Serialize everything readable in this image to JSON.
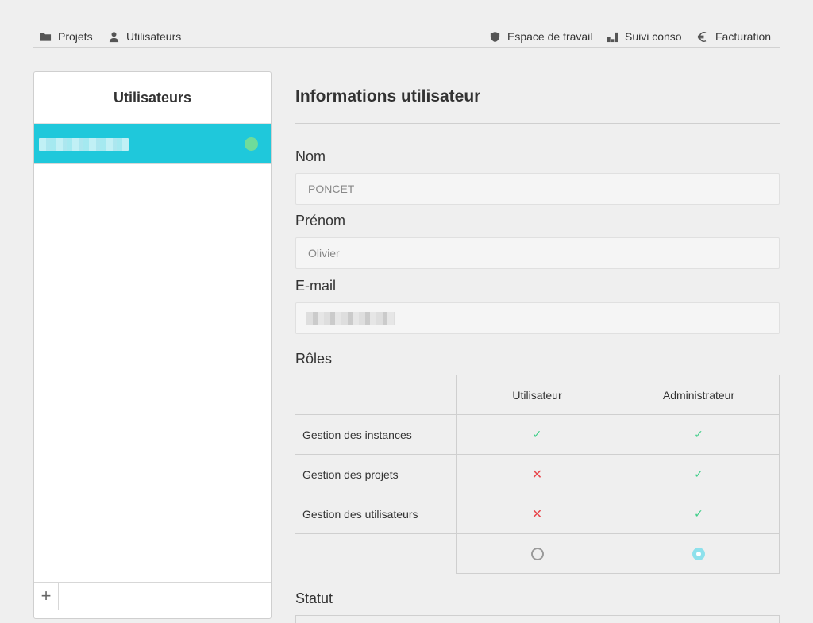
{
  "nav": {
    "left": [
      {
        "label": "Projets",
        "icon": "folder-icon"
      },
      {
        "label": "Utilisateurs",
        "icon": "user-icon"
      }
    ],
    "right": [
      {
        "label": "Espace de travail",
        "icon": "shield-icon"
      },
      {
        "label": "Suivi conso",
        "icon": "bar-chart-icon"
      },
      {
        "label": "Facturation",
        "icon": "euro-icon"
      }
    ]
  },
  "sidebar": {
    "title": "Utilisateurs",
    "selected_user": {
      "status_color": "#6fdc9a"
    },
    "add_label": "+"
  },
  "main": {
    "title": "Informations utilisateur",
    "fields": {
      "nom": {
        "label": "Nom",
        "value": "PONCET"
      },
      "prenom": {
        "label": "Prénom",
        "value": "Olivier"
      },
      "email": {
        "label": "E-mail"
      }
    },
    "roles": {
      "label": "Rôles",
      "columns": [
        "Utilisateur",
        "Administrateur"
      ],
      "rows": [
        {
          "label": "Gestion des instances",
          "values": [
            true,
            true
          ]
        },
        {
          "label": "Gestion des projets",
          "values": [
            false,
            true
          ]
        },
        {
          "label": "Gestion des utilisateurs",
          "values": [
            false,
            true
          ]
        }
      ],
      "selected_column": 1
    },
    "statut_label": "Statut"
  },
  "colors": {
    "accent": "#1fc8db",
    "check": "#3fce88",
    "cross": "#e8484d"
  }
}
